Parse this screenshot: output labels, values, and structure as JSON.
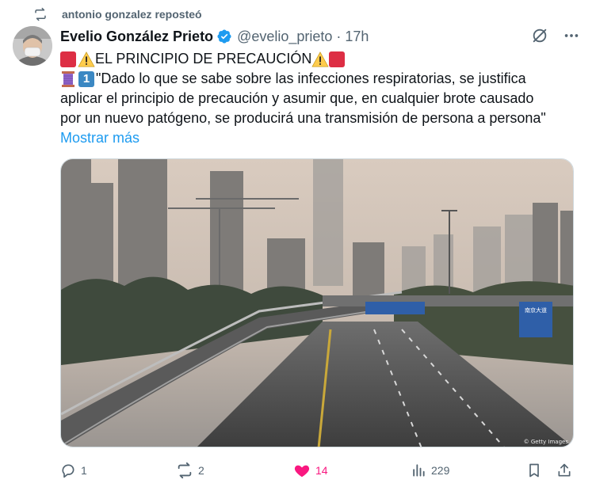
{
  "repost": {
    "text": "antonio gonzalez reposteó"
  },
  "author": {
    "name": "Evelio González Prieto",
    "handle": "@evelio_prieto",
    "separator": "·",
    "time": "17h"
  },
  "tweet": {
    "line1": "EL PRINCIPIO DE PRECAUCIÓN",
    "line2": "\"Dado lo que se sabe sobre las infecciones respiratorias, se justifica",
    "line3": "aplicar el principio de precaución y asumir que, en cualquier brote causado",
    "line4": "por un nuevo patógeno, se producirá una transmisión de persona a persona\"",
    "keycap": "1",
    "show_more": "Mostrar más"
  },
  "media": {
    "credit": "© Getty Images",
    "sign_text": "南京大道"
  },
  "actions": {
    "replies": "1",
    "reposts": "2",
    "likes": "14",
    "views": "229"
  },
  "colors": {
    "accent": "#1d9bf0",
    "like": "#f91880",
    "muted": "#536471",
    "verified": "#1d9bf0"
  },
  "icons": [
    "repost-icon",
    "verified-badge-icon",
    "grok-icon",
    "more-icon",
    "reply-icon",
    "like-icon",
    "views-icon",
    "bookmark-icon",
    "share-icon"
  ]
}
